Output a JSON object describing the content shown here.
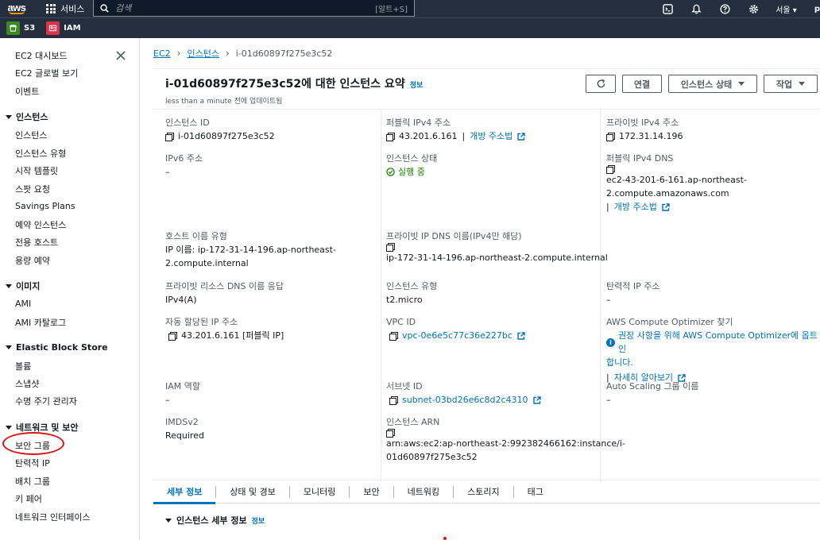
{
  "topbar": {
    "logo": "aws",
    "services_label": "서비스",
    "search_placeholder": "검색",
    "search_shortcut": "[알트+S]",
    "region": "서울",
    "user_initial": "p"
  },
  "favorites": [
    {
      "label": "S3",
      "color": "#3f8624"
    },
    {
      "label": "IAM",
      "color": "#dd344c"
    }
  ],
  "sidebar": {
    "top_items": [
      "EC2 대시보드",
      "EC2 글로벌 보기",
      "이벤트"
    ],
    "sections": [
      {
        "title": "인스턴스",
        "items": [
          "인스턴스",
          "인스턴스 유형",
          "시작 템플릿",
          "스팟 요청",
          "Savings Plans",
          "예약 인스턴스",
          "전용 호스트",
          "용량 예약"
        ]
      },
      {
        "title": "이미지",
        "items": [
          "AMI",
          "AMI 카탈로그"
        ]
      },
      {
        "title": "Elastic Block Store",
        "items": [
          "볼륨",
          "스냅샷",
          "수명 주기 관리자"
        ]
      },
      {
        "title": "네트워크 및 보안",
        "items": [
          "보안 그룹",
          "탄력적 IP",
          "배치 그룹",
          "키 페어",
          "네트워크 인터페이스"
        ]
      }
    ]
  },
  "breadcrumb": {
    "ec2": "EC2",
    "instances": "인스턴스",
    "current": "i-01d60897f275e3c52"
  },
  "summary": {
    "title": "i-01d60897f275e3c52에 대한 인스턴스 요약",
    "info": "정보",
    "updated": "less than a minute 전에 업데이트됨",
    "buttons": {
      "refresh": "refresh",
      "connect": "연결",
      "state": "인스턴스 상태",
      "actions": "작업"
    }
  },
  "fields": {
    "instance_id": {
      "label": "인스턴스 ID",
      "value": "i-01d60897f275e3c52"
    },
    "public_ipv4": {
      "label": "퍼블릭 IPv4 주소",
      "value": "43.201.6.161",
      "link": "개방 주소법"
    },
    "private_ipv4": {
      "label": "프라이빗 IPv4 주소",
      "value": "172.31.14.196"
    },
    "ipv6": {
      "label": "IPv6 주소",
      "value": "–"
    },
    "state": {
      "label": "인스턴스 상태",
      "value": "실행 중"
    },
    "public_dns": {
      "label": "퍼블릭 IPv4 DNS",
      "value_line1": "ec2-43-201-6-161.ap-northeast-",
      "value_line2": "2.compute.amazonaws.com",
      "link": "개방 주소법"
    },
    "hostname_type": {
      "label": "호스트 이름 유형",
      "value_line1": "IP 이름: ip-172-31-14-196.ap-northeast-",
      "value_line2": "2.compute.internal"
    },
    "private_dns": {
      "label": "프라이빗 IP DNS 이름(IPv4만 해당)",
      "value": "ip-172-31-14-196.ap-northeast-2.compute.internal"
    },
    "resource_dns": {
      "label": "프라이빗 리소스 DNS 이름 응답",
      "value": "IPv4(A)"
    },
    "instance_type": {
      "label": "인스턴스 유형",
      "value": "t2.micro"
    },
    "elastic_ip": {
      "label": "탄력적 IP 주소",
      "value": "–"
    },
    "auto_ip": {
      "label": "자동 할당된 IP 주소",
      "value": "43.201.6.161 [퍼블릭 IP]"
    },
    "vpc_id": {
      "label": "VPC ID",
      "value": "vpc-0e6e5c77c36e227bc"
    },
    "optimizer": {
      "label": "AWS Compute Optimizer 찾기",
      "value_line1": "권장 사항을 위해 AWS Compute Optimizer에 옵트인",
      "value_line2": "합니다.",
      "link": "자세히 알아보기"
    },
    "iam_role": {
      "label": "IAM 역할",
      "value": "–"
    },
    "subnet_id": {
      "label": "서브넷 ID",
      "value": "subnet-03bd26e6c8d2c4310"
    },
    "asg_name": {
      "label": "Auto Scaling 그룹 이름",
      "value": "–"
    },
    "imdsv2": {
      "label": "IMDSv2",
      "value": "Required"
    },
    "arn": {
      "label": "인스턴스 ARN",
      "value_line1": "arn:aws:ec2:ap-northeast-2:992382466162:instance/i-",
      "value_line2": "01d60897f275e3c52"
    }
  },
  "tabs": [
    "세부 정보",
    "상태 및 경보",
    "모니터링",
    "보안",
    "네트워킹",
    "스토리지",
    "태그"
  ],
  "details_section": {
    "title": "인스턴스 세부 정보",
    "info": "정보"
  }
}
